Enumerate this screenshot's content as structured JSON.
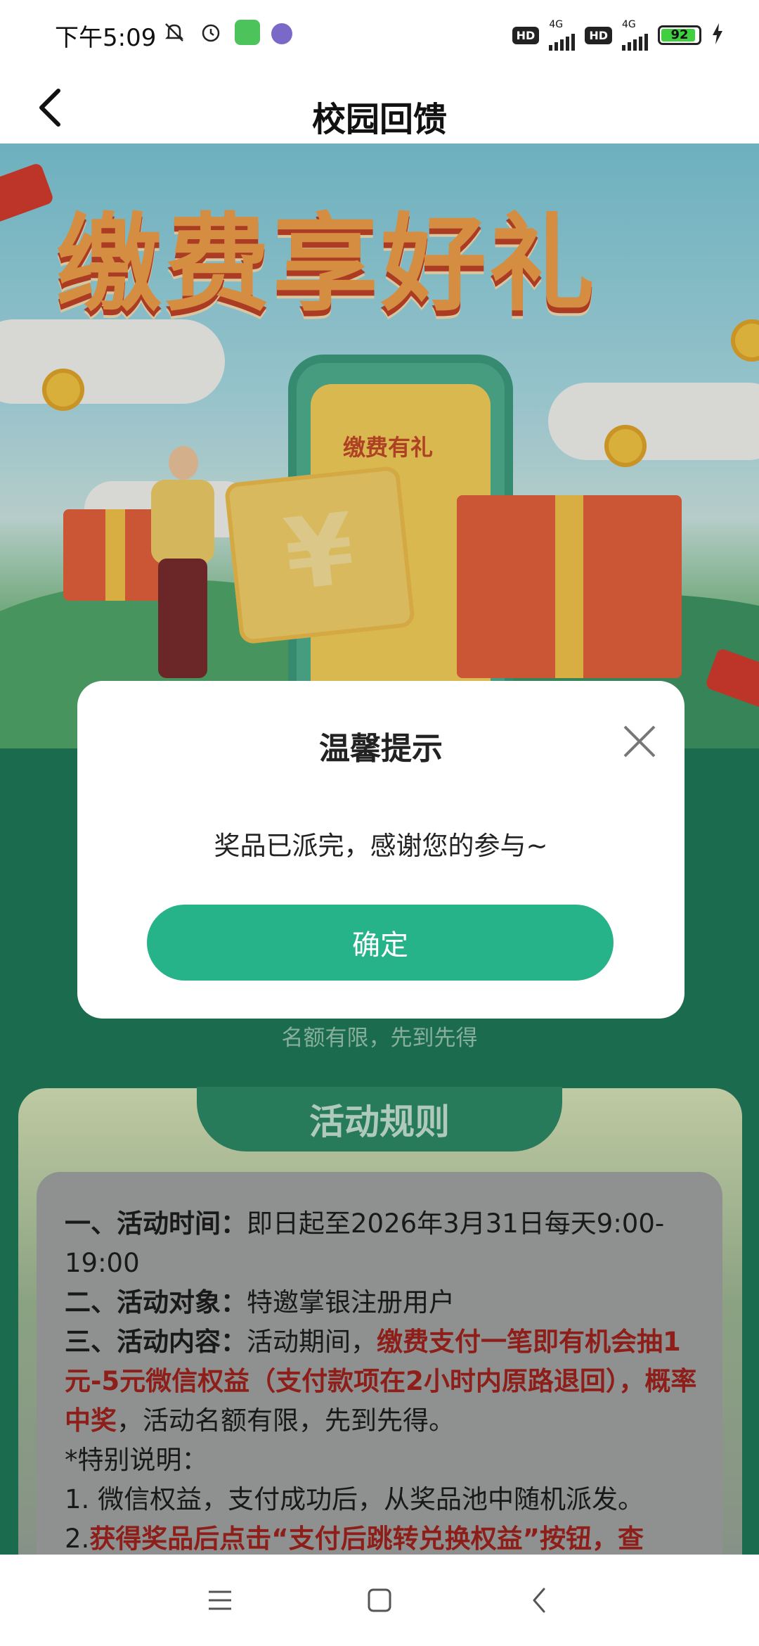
{
  "status_bar": {
    "time": "下午5:09",
    "hd1": "HD",
    "net1": "4G",
    "hd2": "HD",
    "net2": "4G",
    "battery": "92"
  },
  "header": {
    "title": "校园回馈"
  },
  "banner": {
    "title": "缴费享好礼",
    "phone_label": "缴费有礼",
    "scroll_symbol": "¥"
  },
  "modal": {
    "title": "温馨提示",
    "message": "奖品已派完，感谢您的参与~",
    "confirm_label": "确定"
  },
  "limit_note": "名额有限，先到先得",
  "rules": {
    "tab_label": "活动规则",
    "line1_label": "一、活动时间：",
    "line1_text": "即日起至2026年3月31日每天9:00-19:00",
    "line2_label": "二、活动对象：",
    "line2_text": "特邀掌银注册用户",
    "line3_label": "三、活动内容：",
    "line3_text": "活动期间，",
    "line3_red": "缴费支付一笔即有机会抽1元-5元微信权益（支付款项在2小时内原路退回），概率中奖",
    "line3_tail": "，活动名额有限，先到先得。",
    "note_title": "*特别说明：",
    "note1": "1. 微信权益，支付成功后，从奖品池中随机派发。",
    "note2_prefix": "2.",
    "note2_red": "获得奖品后点击“支付后跳转兑换权益”按钮，查"
  },
  "colors": {
    "accent": "#27b38a",
    "rules_red": "#a1231d",
    "background_green": "#1f7a5a"
  },
  "icons": {
    "back": "chevron-left-icon",
    "close": "close-icon",
    "nav_menu": "menu-icon",
    "nav_home": "home-square-icon",
    "nav_back": "back-triangle-icon"
  }
}
